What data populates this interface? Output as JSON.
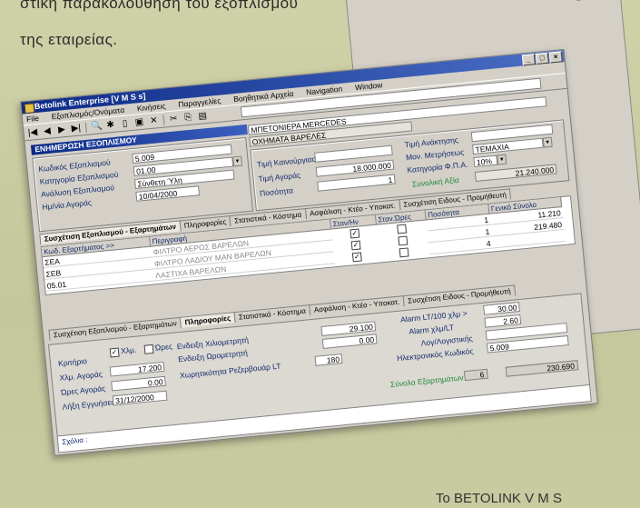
{
  "page": {
    "line1": "στική παρακολούθηση του εξοπλισμού",
    "line2": "της εταιρείας.",
    "footer": "Το BETOLINK V M S"
  },
  "window": {
    "title": "Betolink Enterprise [V M S s]",
    "menu": [
      "Εξοπλισμός/Ονόματα",
      "Κινήσεις",
      "Παραγγελίες",
      "Βοηθητικά Αρχεία",
      "Navigation",
      "Window"
    ],
    "section_title": "ΕΝΗΜΕΡΩΣΗ ΕΞΟΠΛΙΣΜΟΥ",
    "labels": {
      "code": "Κωδικός Εξοπλισμού",
      "category": "Κατηγορία Εξοπλισμού",
      "analysis": "Ανάλυση Εξοπλισμού",
      "purchase_date": "Ημ/νία Αγοράς",
      "new_value": "Τιμή Καινούργιας",
      "purchase_price": "Τιμή Αγοράς",
      "quantity": "Ποσότητα",
      "current_value": "Τιμή Ανάκτησης",
      "unit": "Μον. Μετρήσεως",
      "vat_category": "Κατηγορία Φ.Π.Α.",
      "total_value": "Συνολική Αξία"
    },
    "values": {
      "description": "ΜΠΕΤΟΝΙΕΡΑ MERCEDES",
      "subgroup": "ΟΧΗΜΑΤΑ ΒΑΡΕΛΕΣ",
      "code": "5.009",
      "category": "01.00",
      "analysis": "Σύνθετη Ύλη",
      "purchase_date": "10/04/2000",
      "purchase_price": "18.000.000",
      "quantity": "1",
      "unit": "ΤΕΜΑΧΙΑ",
      "vat_category": "10%",
      "total_value": "21.240.000"
    },
    "tabs_top": [
      "Συσχέτιση Εξοπλισμού - Εξαρτημάτων",
      "Πληροφορίες",
      "Στατιστικά - Κόστημα",
      "Ασφάλιση - Κτέο - Υποκατ.",
      "Συσχέτιση Ειδους - Προμήθευτή"
    ],
    "grid": {
      "headers": [
        "Κωδ. Εξαρτήματος >>",
        "Περιγραφή",
        "Σταν/Ην",
        "Σταν.Ώρες",
        "Ποσότητα",
        "Γενικό Σύνολο"
      ],
      "rows": [
        {
          "code": "ΣΕΑ",
          "desc": "ΦΙΛΤΡΟ ΑΕΡΟΣ ΒΑΡΕΛΩΝ",
          "qty": "1",
          "total": "11.210"
        },
        {
          "code": "ΣΕΒ",
          "desc": "ΦΙΛΤΡΟ ΛΑΔΙΟΥ ΜΑΝ ΒΑΡΕΛΩΝ",
          "qty": "1",
          "total": "219.480"
        },
        {
          "code": "05.01",
          "desc": "ΛΑΣΤΙΧΑ ΒΑΡΕΛΩΝ",
          "qty": "4",
          "total": ""
        }
      ]
    },
    "tabs_bottom": [
      "Συσχέτιση Εξοπλισμού - Εξαρτημάτων",
      "Πληροφορίες",
      "Στατιστικά - Κόστημα",
      "Ασφάλιση - Κτέο - Υποκατ.",
      "Συσχέτιση Ειδους - Προμήθευτή"
    ],
    "detail": {
      "criterion": "Κριτήριο",
      "km_label": "Χλμ.",
      "hours_label": "Ώρες",
      "km_purchase_label": "Χλμ. Αγοράς",
      "km_purchase": "17.200",
      "hours_purchase_label": "Ώρες Αγοράς",
      "hours_purchase": "0.00",
      "expiry_label": "Λήξη Εγγυήσεως",
      "expiry": "31/12/2000",
      "km_indication_label": "Ενδειξη Χιλιομετρητή",
      "km_indication": "29.100",
      "hour_indication_label": "Ενδειξη Ωρομετρητή",
      "hour_indication": "0.00",
      "tank_label": "Χωρητικότητα Ρεζερβουάρ LT",
      "tank": "180",
      "alarm1_label": "Alarm LT/100 χλμ >",
      "alarm1": "30.00",
      "alarm2_label": "Alarm χλμ/LT",
      "alarm2": "2.60",
      "account_label": "Λογ/Λογιστικής",
      "account": "",
      "ecode_label": "Ηλεκτρονικός Κωδικός",
      "ecode": "5.009",
      "totals_label": "Σύνολα Εξαρτημάτων",
      "totals_count": "6",
      "totals_value": "230.690",
      "comments_label": "Σχόλια :"
    }
  }
}
